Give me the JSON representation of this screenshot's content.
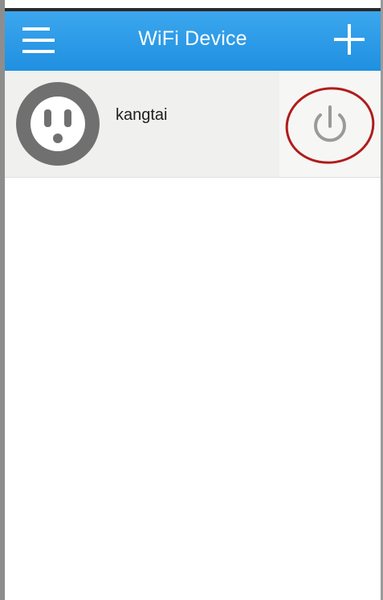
{
  "app_bar": {
    "title": "WiFi Device",
    "menu_icon": "menu-icon",
    "add_icon": "plus-icon",
    "background_color": "#2196f3"
  },
  "devices": [
    {
      "name": "kangtai",
      "icon": "power-outlet-icon",
      "power_icon": "power-icon",
      "highlight_color": "#b01c1c"
    }
  ]
}
